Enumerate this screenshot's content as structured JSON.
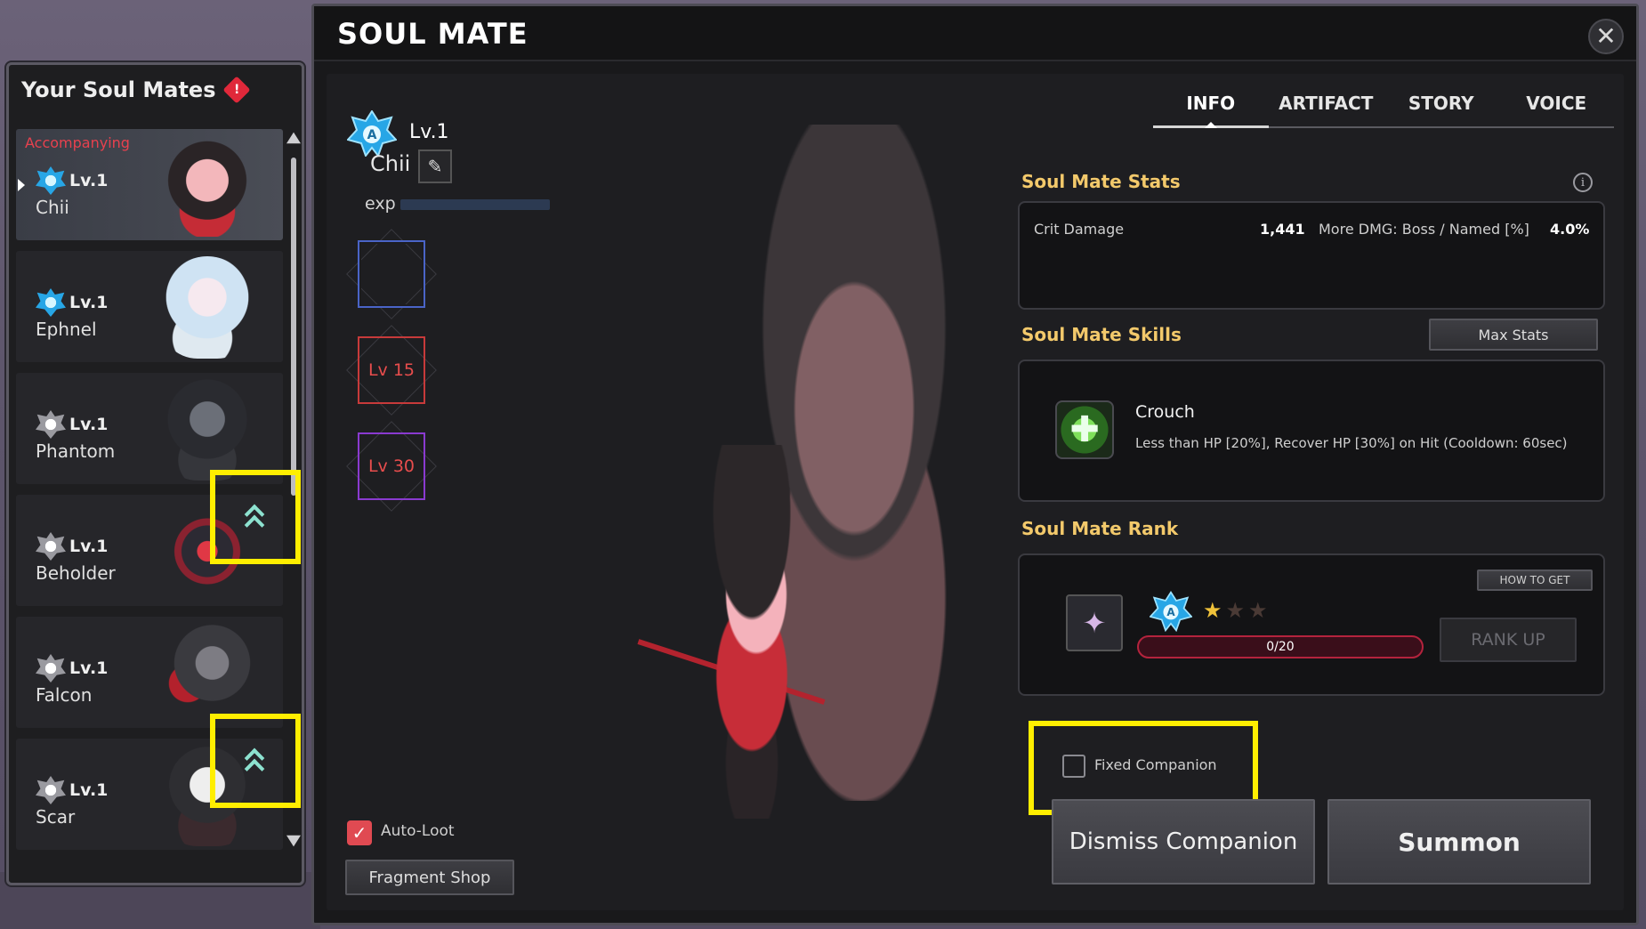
{
  "sidebar": {
    "title": "Your Soul Mates",
    "items": [
      {
        "status": "Accompanying",
        "level": "Lv.1",
        "name": "Chii",
        "badge": "blue-star-badge",
        "active": true
      },
      {
        "status": "",
        "level": "Lv.1",
        "name": "Ephnel",
        "badge": "blue-star-badge",
        "active": false
      },
      {
        "status": "",
        "level": "Lv.1",
        "name": "Phantom",
        "badge": "grey-star-badge",
        "active": false
      },
      {
        "status": "",
        "level": "Lv.1",
        "name": "Beholder",
        "badge": "grey-star-badge",
        "active": false
      },
      {
        "status": "",
        "level": "Lv.1",
        "name": "Falcon",
        "badge": "grey-star-badge",
        "active": false
      },
      {
        "status": "",
        "level": "Lv.1",
        "name": "Scar",
        "badge": "grey-star-badge",
        "active": false
      }
    ]
  },
  "window": {
    "title": "SOUL MATE",
    "close_glyph": "✕"
  },
  "profile": {
    "level": "Lv.1",
    "name": "Chii",
    "exp_label": "exp",
    "exp_fraction": 0,
    "slots": [
      {
        "label": "",
        "color": "blue"
      },
      {
        "label": "Lv 15",
        "color": "red"
      },
      {
        "label": "Lv 30",
        "color": "purple"
      }
    ],
    "auto_loot_label": "Auto-Loot",
    "auto_loot_checked": true,
    "fragment_shop_label": "Fragment Shop"
  },
  "tabs": [
    "INFO",
    "ARTIFACT",
    "STORY",
    "VOICE"
  ],
  "active_tab": "INFO",
  "stats": {
    "title": "Soul Mate Stats",
    "rows": [
      {
        "name": "Crit Damage",
        "value": "1,441",
        "name2": "More DMG: Boss / Named [%]",
        "value2": "4.0%"
      }
    ]
  },
  "skills": {
    "title": "Soul Mate Skills",
    "max_stats_label": "Max Stats",
    "skill_name": "Crouch",
    "skill_desc": "Less than HP [20%], Recover HP [30%] on Hit (Cooldown: 60sec)"
  },
  "rank": {
    "title": "Soul Mate Rank",
    "how_to_get_label": "HOW TO GET",
    "stars_filled": 1,
    "stars_total": 3,
    "progress_text": "0/20",
    "progress_fraction": 0,
    "rank_up_label": "RANK UP"
  },
  "companion": {
    "fixed_label": "Fixed Companion",
    "fixed_checked": false,
    "dismiss_label": "Dismiss Companion",
    "summon_label": "Summon"
  },
  "colors": {
    "accent_gold": "#f3c96b",
    "status_red": "#e8414e",
    "highlight_yellow": "#ffee00",
    "rank_bar_red": "#b4233d"
  }
}
